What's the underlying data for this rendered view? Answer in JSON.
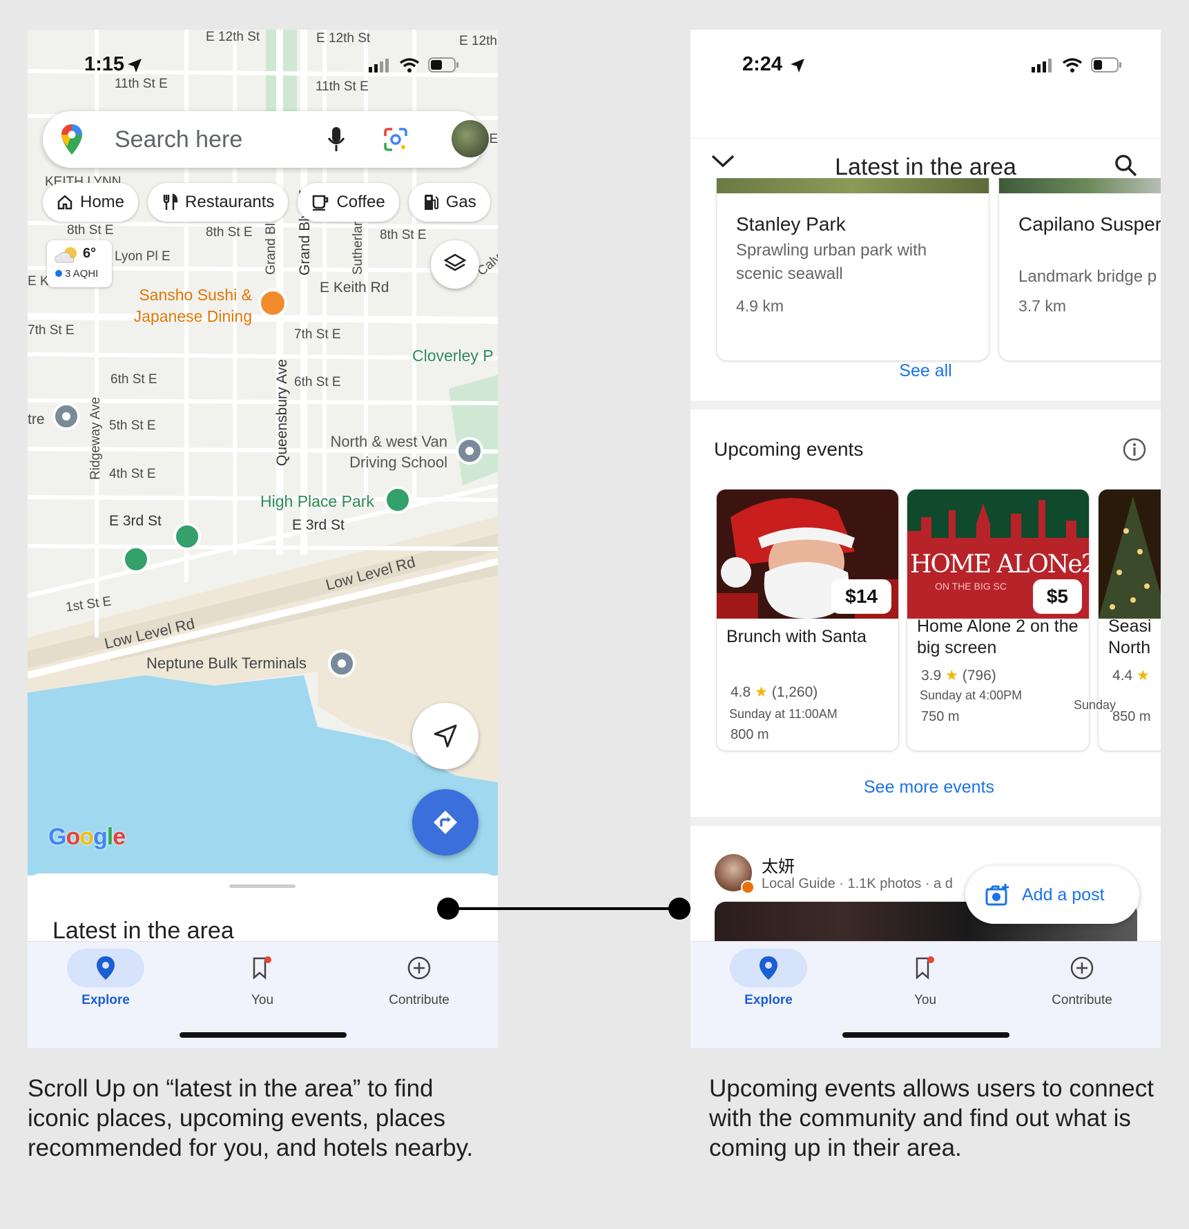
{
  "left_phone": {
    "status_time": "1:15",
    "search": {
      "placeholder": "Search here"
    },
    "chips": [
      "Home",
      "Restaurants",
      "Coffee",
      "Gas"
    ],
    "weather": {
      "temp": "6°",
      "aqi": "3 AQHI"
    },
    "map_labels": {
      "streets": [
        "E 12th St",
        "E 12th St",
        "E 12th",
        "11th St E",
        "11th St E",
        "KEITH LYNN",
        "8th St E",
        "8th St E",
        "8th St E",
        "Lyon Pl E",
        "E Keith Rd",
        "7th St E",
        "7th St E",
        "6th St E",
        "6th St E",
        "5th St E",
        "4th St E",
        "E 3rd St",
        "E 3rd St",
        "1st St E",
        "Low Level Rd",
        "Low Level Rd",
        "Grand Blvd E",
        "Grand Bl",
        "Sutherlar",
        "Queensbury Ave",
        "Ridgeway Ave",
        "E K",
        "Calv",
        "tre",
        "t E"
      ],
      "places": {
        "sushi": "Sansho Sushi & Japanese Dining",
        "cloverley": "Cloverley P",
        "driving_school": "North & west Van Driving School",
        "high_place_park": "High Place Park",
        "neptune": "Neptune Bulk Terminals"
      }
    },
    "google_logo": "Google",
    "sheet_title": "Latest in the area",
    "nav": [
      "Explore",
      "You",
      "Contribute"
    ]
  },
  "right_phone": {
    "status_time": "2:24",
    "header_title": "Latest in the area",
    "places": [
      {
        "name": "Stanley Park",
        "desc": "Sprawling urban park with scenic seawall",
        "dist": "4.9 km"
      },
      {
        "name": "Capilano Suspension Bridge Park",
        "name_visible": "Capilano Susper Bridge Park",
        "desc": "Landmark bridge p",
        "dist": "3.7 km"
      }
    ],
    "see_all": "See all",
    "events_title": "Upcoming events",
    "events": [
      {
        "name": "Brunch with Santa",
        "price": "$14",
        "rating": "4.8",
        "reviews": "(1,260)",
        "time": "Sunday at 11:00AM",
        "dist": "800 m"
      },
      {
        "name": "Home Alone 2 on the big screen",
        "price": "$5",
        "poster": "HOME ALONe2",
        "poster_sub": "ON THE BIG SC",
        "rating": "3.9",
        "reviews": "(796)",
        "time": "Sunday at 4:00PM",
        "dist": "750 m"
      },
      {
        "name": "Seasi North",
        "rating": "4.4",
        "time": "Sunday",
        "dist": "850 m"
      }
    ],
    "see_more_events": "See more events",
    "post": {
      "author": "太妍",
      "meta": "Local Guide · 1.1K photos · a d"
    },
    "add_post": "Add a post",
    "nav": [
      "Explore",
      "You",
      "Contribute"
    ]
  },
  "captions": {
    "left": "Scroll Up on “latest in the area” to find iconic places, upcoming events, places recommended for you, and hotels nearby.",
    "right": "Upcoming events allows users to connect with the community and find out what is coming up in their area."
  }
}
